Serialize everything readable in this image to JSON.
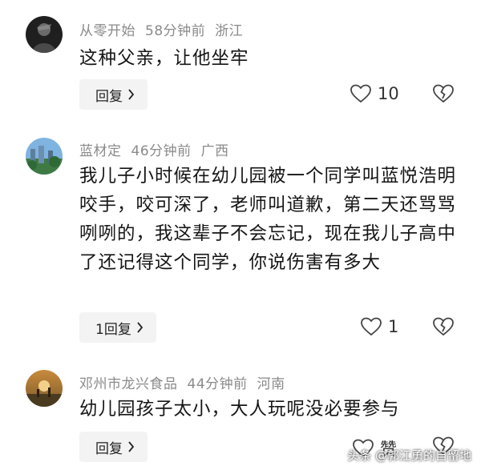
{
  "comments": [
    {
      "username": "从零开始",
      "time": "58分钟前",
      "location": "浙江",
      "text": "这种父亲，让他坐牢",
      "reply_label": "回复",
      "likes": "10",
      "avatar_icon": "dark-portrait-avatar"
    },
    {
      "username": "蓝材定",
      "time": "46分钟前",
      "location": "广西",
      "text": "我儿子小时候在幼儿园被一个同学叫蓝悦浩明咬手，咬可深了，老师叫道歉，第二天还骂骂咧咧的，我这辈子不会忘记，现在我儿子高中了还记得这个同学，你说伤害有多大",
      "reply_label": "1回复",
      "likes": "1",
      "avatar_icon": "landscape-avatar"
    },
    {
      "username": "邓州市龙兴食品",
      "time": "44分钟前",
      "location": "河南",
      "text": "幼儿园孩子太小，大人玩呢没必要参与",
      "reply_label": "回复",
      "likes": "赞",
      "avatar_icon": "sunset-avatar"
    }
  ],
  "watermark": "头条 @郭江勇的自留地",
  "colors": {
    "meta": "#8a8a8a",
    "text": "#151515",
    "button_bg": "#f3f3f3"
  }
}
